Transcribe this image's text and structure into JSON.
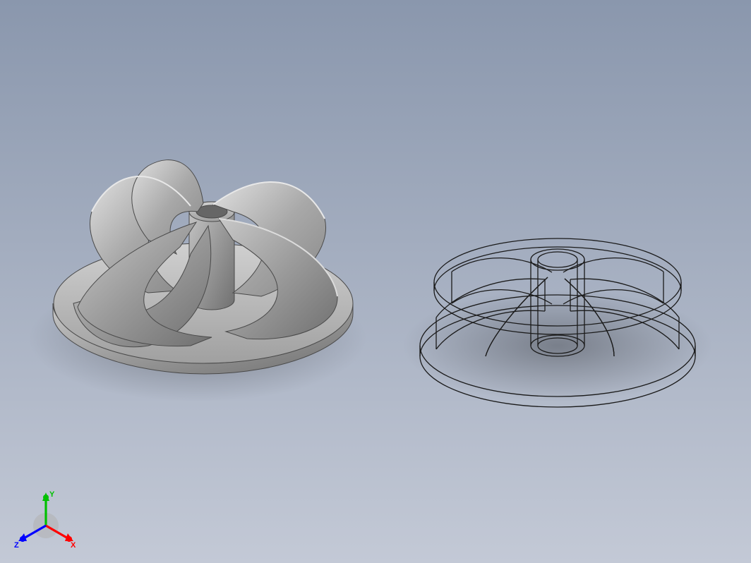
{
  "triad": {
    "x_label": "X",
    "y_label": "Y",
    "z_label": "Z",
    "x_color": "#ff0000",
    "y_color": "#00c000",
    "z_color": "#0000ff",
    "origin_fill": "#b0b0b0"
  },
  "models": {
    "left": {
      "kind": "shaded-impeller",
      "blade_count": 6,
      "material": "steel-grey",
      "hollow_hub": true
    },
    "right": {
      "kind": "wireframe-impeller",
      "blade_count": 6,
      "material": "none",
      "hollow_hub": true
    }
  },
  "background": {
    "top_color": "#8a97ad",
    "bottom_color": "#c3c9d6"
  }
}
